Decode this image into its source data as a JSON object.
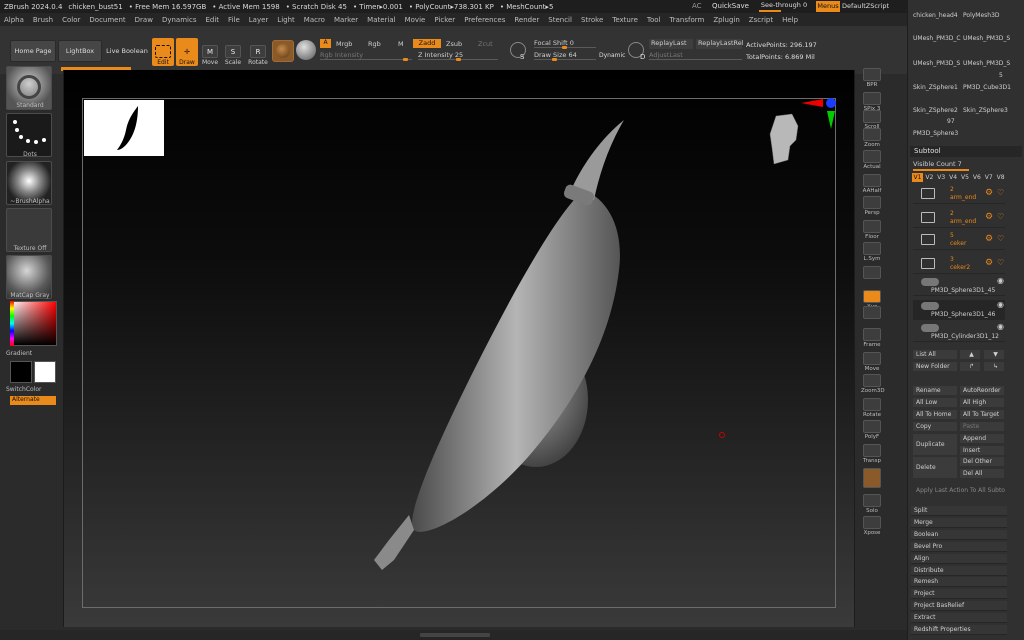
{
  "titlebar": {
    "app": "ZBrush 2024.0.4",
    "file": "chicken_bust51",
    "free_mem": "• Free Mem 16.597GB",
    "active_mem": "• Active Mem 1598",
    "scratch": "• Scratch Disk 45",
    "timer": "• Timer▸0.001",
    "polycount": "• PolyCount▸738.301 KP",
    "meshcount": "• MeshCount▸5",
    "ac": "AC",
    "quicksave": "QuickSave",
    "seethrough": "See-through  0",
    "menus": "Menus",
    "script": "DefaultZScript"
  },
  "menubar": [
    "Alpha",
    "Brush",
    "Color",
    "Document",
    "Draw",
    "Dynamics",
    "Edit",
    "File",
    "Layer",
    "Light",
    "Macro",
    "Marker",
    "Material",
    "Movie",
    "Picker",
    "Preferences",
    "Render",
    "Stencil",
    "Stroke",
    "Texture",
    "Tool",
    "Transform",
    "Zplugin",
    "Zscript",
    "Help"
  ],
  "toolbar": {
    "home": "Home Page",
    "lightbox": "LightBox",
    "liveboolean": "Live Boolean",
    "edit": "Edit",
    "draw": "Draw",
    "move": "Move",
    "scale": "Scale",
    "rotate": "Rotate",
    "a": "A",
    "mrgb": "Mrgb",
    "rgb": "Rgb",
    "m": "M",
    "zadd": "Zadd",
    "zsub": "Zsub",
    "zcut": "Zcut",
    "rgb_intensity": "Rgb Intensity",
    "z_intensity": "Z Intensity 25",
    "focal_shift": "Focal Shift 0",
    "draw_size": "Draw Size 64",
    "dynamic": "Dynamic",
    "s": "S",
    "d": "D",
    "replaylast": "ReplayLast",
    "replaylastrel": "ReplayLastRel",
    "adjustlast": "AdjustLast",
    "activepoints": "ActivePoints: 296.197",
    "totalpoints": "TotalPoints: 6.869 Mil"
  },
  "left": {
    "standard": "Standard",
    "dots": "Dots",
    "brushalpha": "~BrushAlpha",
    "textureoff": "Texture Off",
    "matcap": "MatCap Gray",
    "gradient": "Gradient",
    "switchcolor": "SwitchColor",
    "alternate": "Alternate"
  },
  "rightstrip": [
    "BPR",
    "SPix 3",
    "Scroll",
    "Zoom",
    "Actual",
    "AAHalf",
    "Persp",
    "Floor",
    "L.Sym",
    "",
    "Xyz",
    "",
    "Frame",
    "Move",
    "Zoom3D",
    "Rotate",
    "PolyF",
    "Transp",
    "",
    "Solo",
    "Xpose"
  ],
  "tools": {
    "r1a": "chicken_head4",
    "r1b": "PolyMesh3D",
    "r2a": "UMesh_PM3D_C",
    "r2b": "UMesh_PM3D_S",
    "r3a": "UMesh_PM3D_S",
    "r3b": "UMesh_PM3D_S",
    "r4a": "Skin_ZSphere1",
    "r4b": "PM3D_Cube3D1",
    "r5a": "Skin_ZSphere2",
    "r5b": "Skin_ZSphere3",
    "r6a": "PM3D_Sphere3",
    "r6count": "97",
    "r4count": "5"
  },
  "subtool": {
    "title": "Subtool",
    "visible": "Visible Count 7",
    "tabs": [
      "V1",
      "V2",
      "V3",
      "V4",
      "V5",
      "V6",
      "V7",
      "V8"
    ],
    "folders": [
      {
        "num": "2",
        "name": "arm_end"
      },
      {
        "num": "2",
        "name": "arm_end"
      },
      {
        "num": "5",
        "name": "ceker"
      },
      {
        "num": "3",
        "name": "ceker2"
      }
    ],
    "items": [
      "PM3D_Sphere3D1_45",
      "PM3D_Sphere3D1_46",
      "PM3D_Cylinder3D1_12"
    ],
    "listall": "List All",
    "newfolder": "New Folder",
    "rename": "Rename",
    "autoreorder": "AutoReorder",
    "alllow": "All Low",
    "allhigh": "All High",
    "alltohome": "All To Home",
    "alltotarget": "All To Target",
    "copy": "Copy",
    "paste": "Paste",
    "duplicate": "Duplicate",
    "append": "Append",
    "insert": "Insert",
    "delete": "Delete",
    "delother": "Del Other",
    "delall": "Del All",
    "applylast": "Apply Last Action To All Subtoo",
    "sections": [
      "Split",
      "Merge",
      "Boolean",
      "Bevel Pro",
      "Align",
      "Distribute",
      "Remesh",
      "Project",
      "Project BasRelief",
      "Extract",
      "Redshift Properties"
    ]
  },
  "colors": {
    "accent": "#e98a1a",
    "panel": "#303030",
    "toolbar": "#333333"
  }
}
